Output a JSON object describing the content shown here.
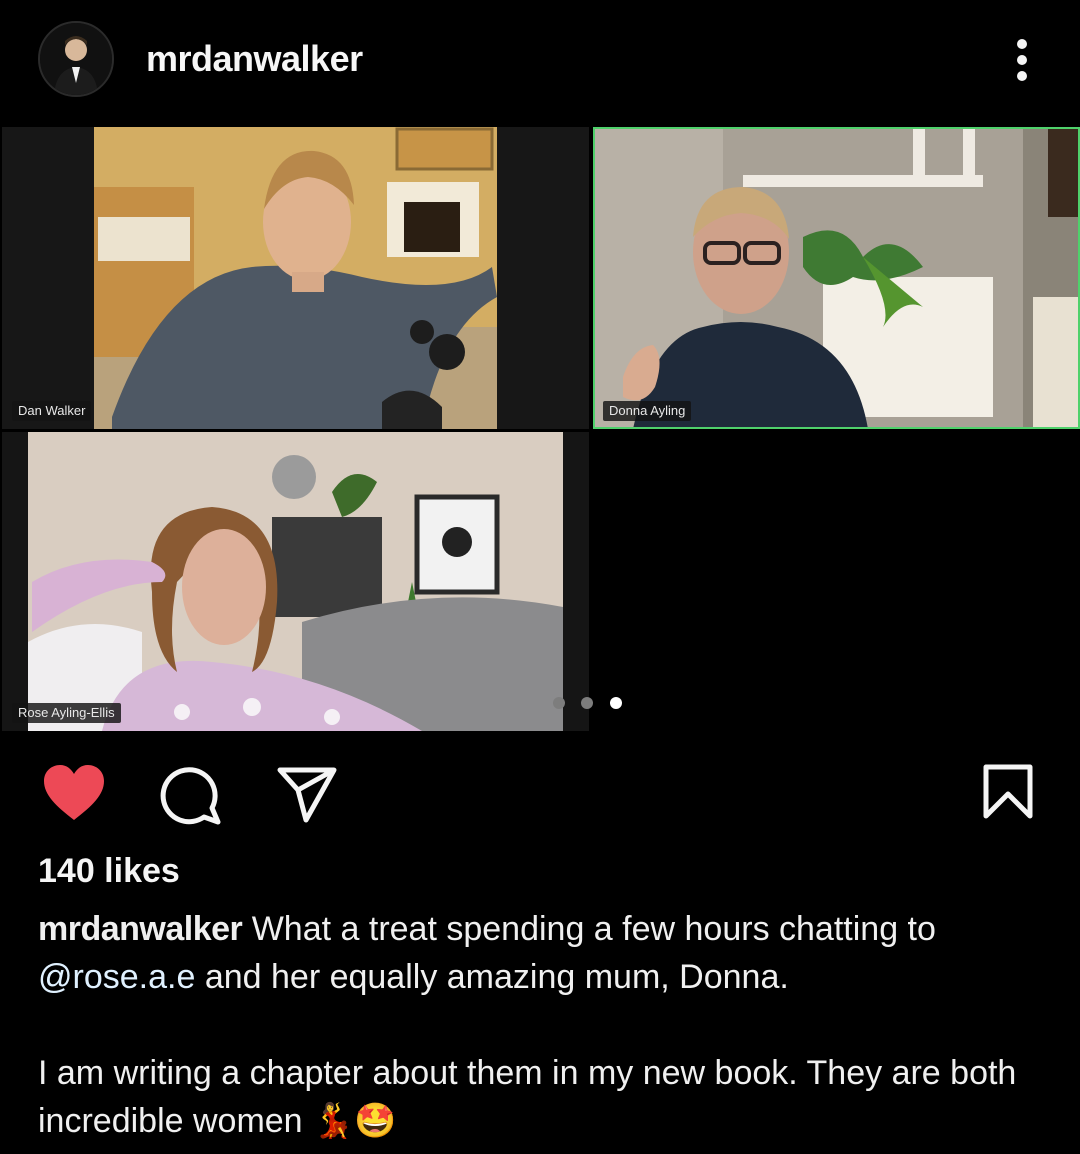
{
  "header": {
    "username": "mrdanwalker",
    "avatar_icon": "profile-photo",
    "more_icon": "vertical-ellipsis-icon"
  },
  "post": {
    "participants": [
      {
        "name": "Dan Walker"
      },
      {
        "name": "Donna Ayling"
      },
      {
        "name": "Rose Ayling-Ellis"
      }
    ],
    "carousel": {
      "count": 3,
      "active_index": 2
    },
    "active_speaker_color": "#4fd16b"
  },
  "actions": {
    "liked": true,
    "like_color": "#ed4956",
    "icons": [
      "heart-icon",
      "comment-icon",
      "share-icon",
      "bookmark-icon"
    ]
  },
  "likes": {
    "text": "140 likes"
  },
  "caption": {
    "username": "mrdanwalker",
    "line1": "What a treat spending a few hours chatting to",
    "mention": "@rose.a.e",
    "line2_rest": " and her equally amazing mum, Donna.",
    "para2": "I am writing a chapter about them in my new book. They are both incredible women",
    "emoji": "💃🤩"
  }
}
